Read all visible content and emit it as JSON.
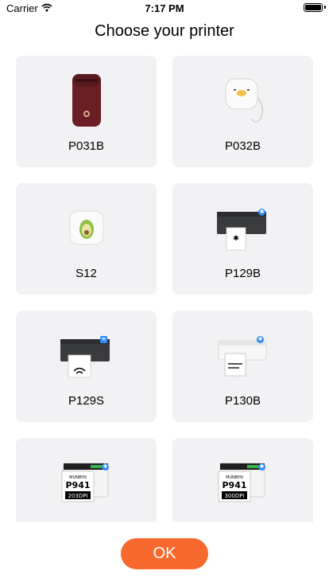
{
  "status_bar": {
    "carrier": "Carrier",
    "time": "7:17 PM",
    "wifi_icon": "wifi-icon",
    "battery_icon": "battery-icon"
  },
  "page": {
    "title": "Choose your printer"
  },
  "printers": [
    {
      "label": "P031B",
      "image": "p031b-printer-image"
    },
    {
      "label": "P032B",
      "image": "p032b-printer-image"
    },
    {
      "label": "S12",
      "image": "s12-printer-image"
    },
    {
      "label": "P129B",
      "image": "p129b-printer-image",
      "badge": "bluetooth-badge-icon"
    },
    {
      "label": "P129S",
      "image": "p129s-printer-image",
      "badge": "wifi-badge-icon"
    },
    {
      "label": "P130B",
      "image": "p130b-printer-image",
      "badge": "bluetooth-badge-icon"
    },
    {
      "label": "",
      "image": "p941-203dpi-printer-image",
      "badge": "bluetooth-badge-icon",
      "image_text": [
        "MUNBYN",
        "P941",
        "203DPI"
      ]
    },
    {
      "label": "",
      "image": "p941-300dpi-printer-image",
      "badge": "bluetooth-badge-icon",
      "image_text": [
        "MUNBYN",
        "P941",
        "300DPI"
      ]
    }
  ],
  "footer": {
    "ok_label": "OK"
  },
  "colors": {
    "card_bg": "#f2f2f5",
    "accent": "#f7692c",
    "bluetooth": "#2f8af5"
  }
}
